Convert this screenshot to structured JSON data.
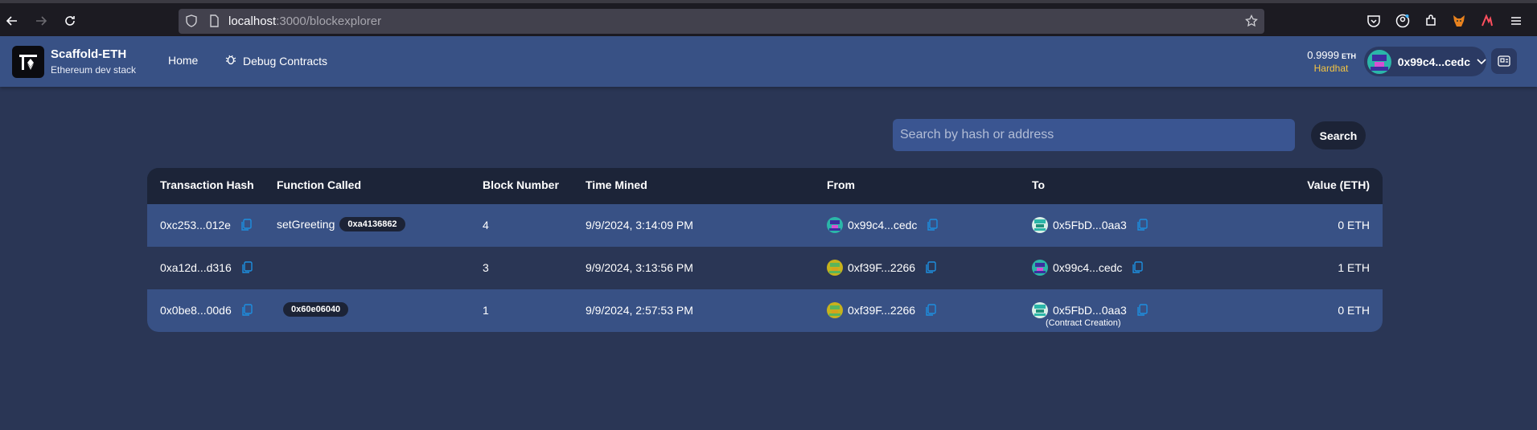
{
  "browser": {
    "url_host": "localhost",
    "url_path": ":3000/blockexplorer"
  },
  "header": {
    "brand_title": "Scaffold-ETH",
    "brand_subtitle": "Ethereum dev stack",
    "nav": {
      "home": "Home",
      "debug": "Debug Contracts"
    },
    "balance": {
      "value": "0.9999",
      "unit": "ETH",
      "network": "Hardhat"
    },
    "account": {
      "address": "0x99c4...cedc"
    }
  },
  "search": {
    "placeholder": "Search by hash or address",
    "button_label": "Search"
  },
  "table": {
    "columns": [
      "Transaction Hash",
      "Function Called",
      "Block Number",
      "Time Mined",
      "From",
      "To",
      "Value (ETH)"
    ],
    "rows": [
      {
        "hash": "0xc253...012e",
        "function_name": "setGreeting",
        "function_selector": "0xa4136862",
        "block": "4",
        "time": "9/9/2024, 3:14:09 PM",
        "from": "0x99c4...cedc",
        "to": "0x5FbD...0aa3",
        "to_note": "",
        "value": "0 ETH"
      },
      {
        "hash": "0xa12d...d316",
        "function_name": "",
        "function_selector": "",
        "block": "3",
        "time": "9/9/2024, 3:13:56 PM",
        "from": "0xf39F...2266",
        "to": "0x99c4...cedc",
        "to_note": "",
        "value": "1 ETH"
      },
      {
        "hash": "0x0be8...00d6",
        "function_name": "",
        "function_selector": "0x60e06040",
        "block": "1",
        "time": "9/9/2024, 2:57:53 PM",
        "from": "0xf39F...2266",
        "to": "0x5FbD...0aa3",
        "to_note": "(Contract Creation)",
        "value": "0 ETH"
      }
    ]
  },
  "colors": {
    "page_bg": "#2a3655",
    "header_bg": "#385185",
    "row_highlight": "#385185",
    "table_header_bg": "#1c2438",
    "copy_icon": "#1d8fe0",
    "network_label": "#f5c542"
  },
  "icons": [
    "back-arrow-icon",
    "forward-arrow-icon",
    "reload-icon",
    "shield-icon",
    "page-icon",
    "star-icon",
    "pocket-icon",
    "account-icon",
    "extensions-icon",
    "fox-icon",
    "hamburger-icon",
    "bug-icon",
    "copy-icon",
    "qr-icon",
    "chevron-down-icon"
  ]
}
